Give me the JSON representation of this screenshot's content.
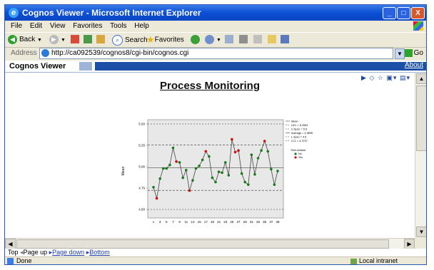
{
  "window": {
    "title": "Cognos Viewer - Microsoft Internet Explorer",
    "controls": {
      "minimize": "_",
      "maximize": "□",
      "close": "X"
    }
  },
  "menu": [
    "File",
    "Edit",
    "View",
    "Favorites",
    "Tools",
    "Help"
  ],
  "toolbar": {
    "back": "Back",
    "search": "Search",
    "favorites": "Favorites"
  },
  "address": {
    "label": "Address",
    "url": "http://ca092539/cognos8/cgi-bin/cognos.cgi",
    "go": "Go"
  },
  "viewer": {
    "tab": "Cognos Viewer",
    "about": "About"
  },
  "report": {
    "title": "Process Monitoring"
  },
  "chart_data": {
    "type": "line",
    "ylabel": "Mean",
    "ylim": [
      4.4,
      5.55
    ],
    "yticks": [
      "4.50",
      "4.75",
      "5.00",
      "5.25",
      "5.50"
    ],
    "yticks_num": [
      4.5,
      4.75,
      5.0,
      5.25,
      5.5
    ],
    "x": [
      "1",
      "2",
      "3",
      "4",
      "5",
      "6",
      "7",
      "8",
      "9",
      "10",
      "11",
      "12",
      "13",
      "14",
      "15",
      "16",
      "17",
      "18",
      "19",
      "20",
      "21",
      "22",
      "23",
      "24",
      "25",
      "26",
      "27",
      "28",
      "29",
      "30",
      "31",
      "32",
      "33",
      "34",
      "35",
      "36",
      "37",
      "38",
      "39"
    ],
    "xticks": [
      "1",
      "3",
      "5",
      "7",
      "9",
      "11",
      "13",
      "15",
      "17",
      "19",
      "21",
      "23",
      "25",
      "27",
      "29",
      "31",
      "33",
      "35",
      "37",
      "39"
    ],
    "values": [
      4.76,
      4.63,
      4.86,
      4.98,
      4.98,
      5.02,
      5.22,
      5.06,
      5.05,
      4.87,
      4.96,
      4.72,
      4.84,
      4.98,
      5.01,
      5.08,
      5.18,
      5.12,
      4.87,
      4.82,
      4.94,
      4.93,
      5.05,
      4.9,
      5.32,
      5.17,
      5.19,
      4.92,
      4.82,
      4.79,
      5.14,
      4.91,
      5.1,
      5.19,
      5.3,
      5.18,
      4.97,
      4.79,
      4.95
    ],
    "flagged": [
      2,
      8,
      12,
      17,
      25,
      26,
      27,
      35
    ],
    "ucl": 5.2554,
    "lcl": 4.7237,
    "average": 4.9895,
    "u_spec": 5.5,
    "l_spec": 4.5,
    "legend": [
      "Mean",
      "UCL = 5.2554",
      "U Spec = 5.5",
      "Average = 4.9895",
      "L Spec = 4.5",
      "LCL = 4.7237"
    ],
    "rule_legend": {
      "title": "Rule violation",
      "items": [
        "No",
        "Yes"
      ]
    },
    "colors": {
      "ok": "#1a7a1a",
      "violation": "#cc1111",
      "line": "#444444",
      "center": "#222222",
      "control": "#333333",
      "plot_bg": "#e8e8e8"
    }
  },
  "pager": {
    "top": "Top",
    "page_up": "Page up",
    "page_down": "Page down",
    "bottom": "Bottom"
  },
  "status": {
    "left": "Done",
    "right": "Local intranet"
  }
}
